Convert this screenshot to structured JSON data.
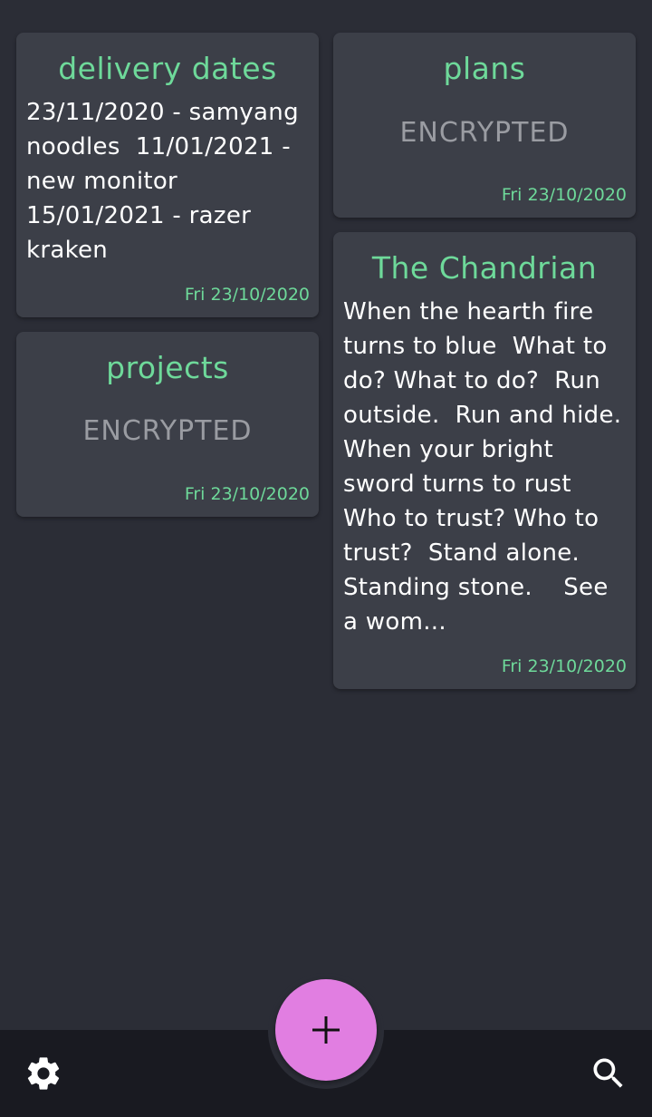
{
  "notes": [
    {
      "title": "delivery dates",
      "body": "23/11/2020 - samyang noodles  11/01/2021 - new monitor 15/01/2021 - razer kraken",
      "date": "Fri 23/10/2020"
    },
    {
      "title": "plans",
      "encrypted_label": "ENCRYPTED",
      "date": "Fri 23/10/2020"
    },
    {
      "title": "projects",
      "encrypted_label": "ENCRYPTED",
      "date": "Fri 23/10/2020"
    },
    {
      "title": "The Chandrian",
      "body": "When the hearth fire turns to blue  What to do? What to do?  Run outside.  Run and hide. When your bright sword turns to rust Who to trust? Who to trust?  Stand alone. Standing stone.    See a wom...",
      "date": "Fri 23/10/2020"
    }
  ],
  "bottom_bar": {
    "settings_icon": "gear-icon",
    "add_icon": "plus-icon",
    "search_icon": "search-icon"
  },
  "colors": {
    "background": "#2b2d36",
    "card": "#3c3f48",
    "accent_green": "#6ed99a",
    "fab": "#e17ee1",
    "bottom_bar": "#191a21"
  }
}
